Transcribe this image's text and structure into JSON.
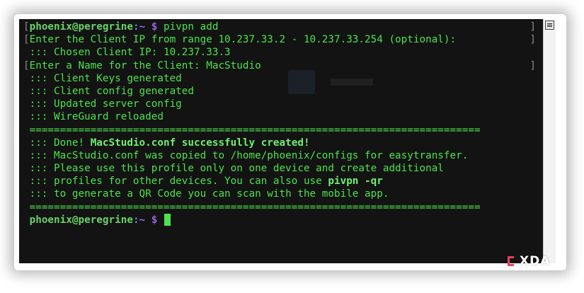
{
  "terminal": {
    "prompt_user": "phoenix@peregrine",
    "prompt_path": ":~",
    "prompt_symbol": "$",
    "command": " pivpn add",
    "lines": {
      "ip_range": "Enter the Client IP from range 10.237.33.2 - 10.237.33.254 (optional):",
      "chosen_ip": " ::: Chosen Client IP: 10.237.33.3",
      "name_prompt": "Enter a Name for the Client: MacStudio",
      "keys": " ::: Client Keys generated",
      "config": " ::: Client config generated",
      "server": " ::: Updated server config",
      "reload": " ::: WireGuard reloaded",
      "separator": " ==========================================================================",
      "done_prefix": " ::: Done! ",
      "done_bold": "MacStudio.conf successfully created!",
      "copied": " ::: MacStudio.conf was copied to /home/phoenix/configs for easytransfer.",
      "profile_1": " ::: Please use this profile only on one device and create additional",
      "profile_2_prefix": " ::: profiles for other devices. You can also use ",
      "profile_2_bold": "pivpn -qr",
      "qr": " ::: to generate a QR Code you can scan with the mobile app."
    }
  },
  "watermark": {
    "text": "XDA"
  }
}
